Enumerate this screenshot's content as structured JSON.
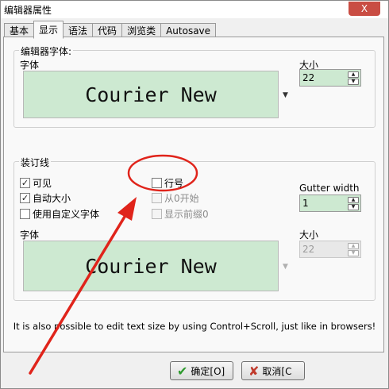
{
  "window": {
    "title": "编辑器属性",
    "close_label": "X"
  },
  "tabs": [
    {
      "label": "基本"
    },
    {
      "label": "显示"
    },
    {
      "label": "语法"
    },
    {
      "label": "代码"
    },
    {
      "label": "浏览类"
    },
    {
      "label": "Autosave"
    }
  ],
  "editor_font": {
    "group_label": "编辑器字体:",
    "font_label": "字体",
    "preview_text": "Courier New",
    "size_label": "大小",
    "size_value": "22"
  },
  "gutter": {
    "group_label": "装订线",
    "visible_label": "可见",
    "visible_checked": true,
    "autosize_label": "自动大小",
    "autosize_checked": true,
    "custom_font_label": "使用自定义字体",
    "custom_font_checked": false,
    "line_numbers_label": "行号",
    "line_numbers_checked": false,
    "start_zero_label": "从0开始",
    "show_leading_zeros_label": "显示前缀0",
    "gutter_width_label": "Gutter width",
    "gutter_width_value": "1",
    "font_label": "字体",
    "preview_text": "Courier New",
    "size_label": "大小",
    "size_value": "22"
  },
  "hint": "It is also possible to edit text size by using Control+Scroll, just like in browsers!",
  "buttons": {
    "ok_label": "确定[O]",
    "cancel_label": "取消[C"
  },
  "colors": {
    "preview_bg": "#cde9d1",
    "annotation": "#e0241b"
  },
  "icons": {
    "check": "✓",
    "ok": "✔",
    "cancel": "✘",
    "up": "▲",
    "down": "▼"
  }
}
